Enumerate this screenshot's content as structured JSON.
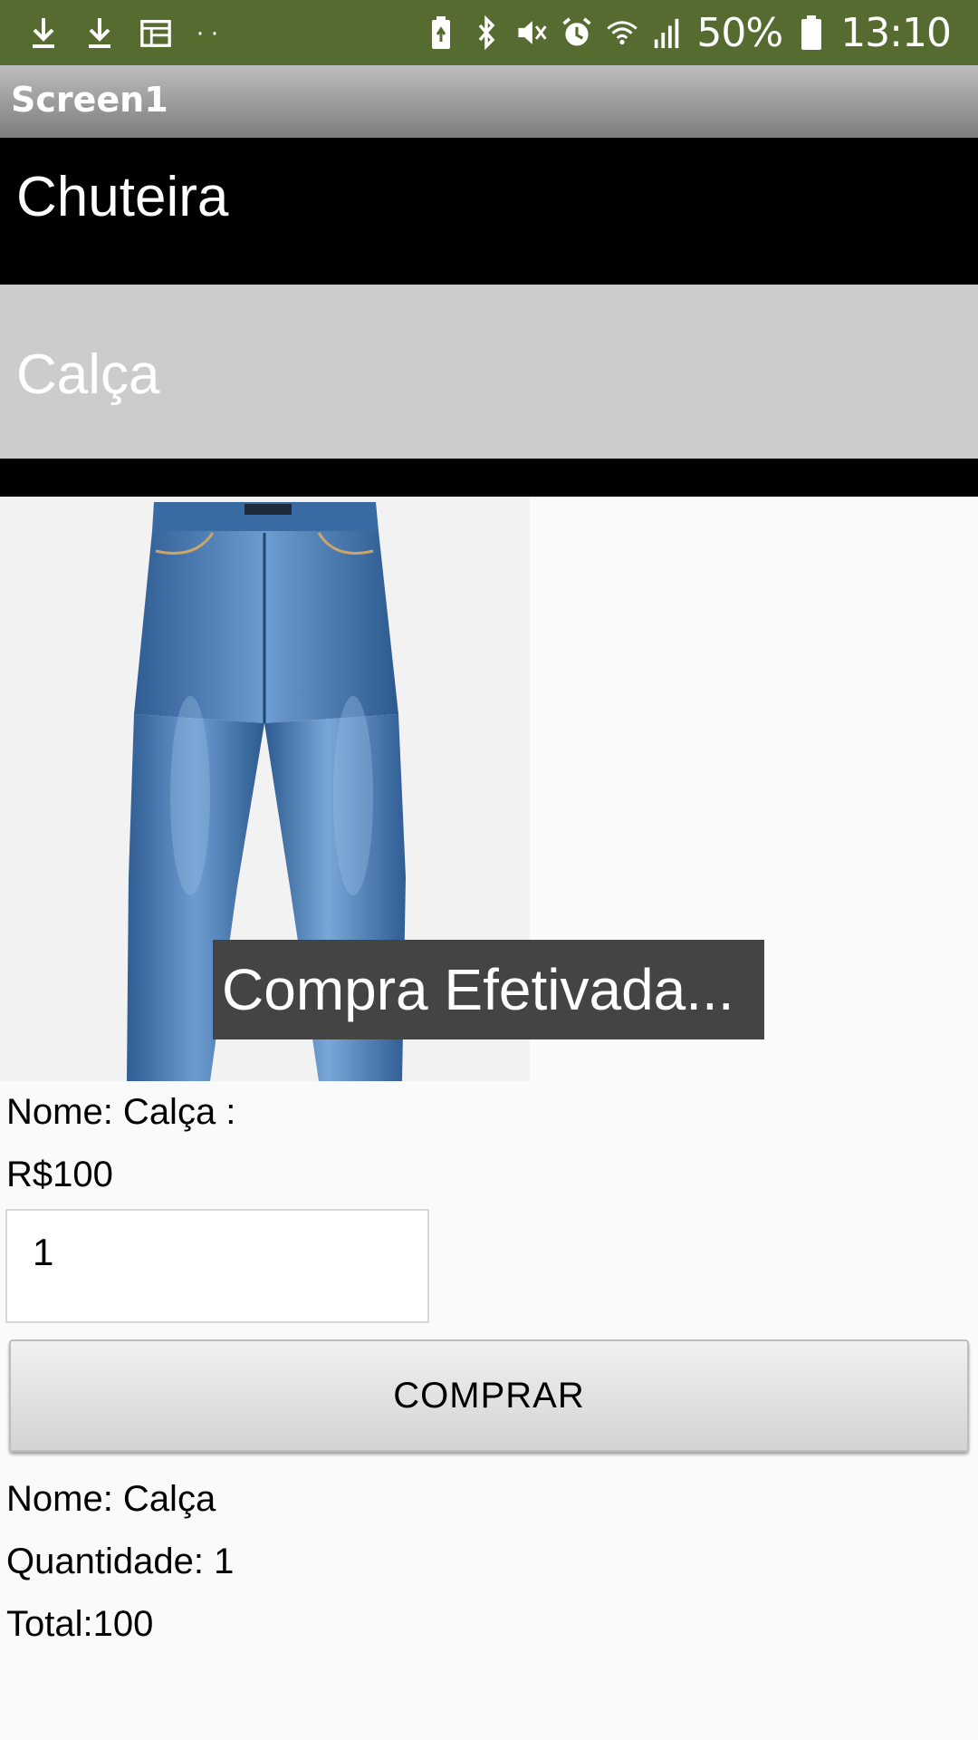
{
  "status_bar": {
    "left_icons": [
      "download-icon",
      "download-icon",
      "calendar-icon",
      "more-dots-icon"
    ],
    "right_icons": [
      "battery-saver-icon",
      "bluetooth-icon",
      "mute-icon",
      "alarm-icon",
      "wifi-icon",
      "signal-icon",
      "battery-icon"
    ],
    "battery_percent": "50%",
    "time": "13:10",
    "color": "#556b2f"
  },
  "titlebar": {
    "title": "Screen1"
  },
  "list": {
    "items": [
      {
        "label": "Chuteira"
      },
      {
        "label": "Calça"
      }
    ]
  },
  "product": {
    "image": "jeans-image",
    "name_label": "Nome: Calça :",
    "price_label": "R$100"
  },
  "toast": {
    "message": "Compra Efetivada..."
  },
  "quantity": {
    "value": "1"
  },
  "buy_button": {
    "label": "COMPRAR"
  },
  "summary": {
    "name": "Nome: Calça",
    "quantity": "Quantidade: 1",
    "total": "Total:100"
  }
}
